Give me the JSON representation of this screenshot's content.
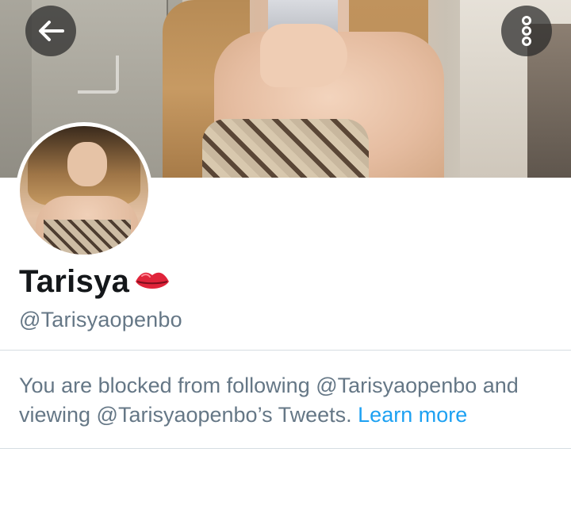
{
  "profile": {
    "display_name": "Tarisya",
    "name_emoji": "lips-icon",
    "handle": "@Tarisyaopenbo"
  },
  "header": {
    "back_icon": "back-arrow-icon",
    "more_icon": "more-options-icon"
  },
  "blocked": {
    "line1": "You are blocked from following @Tarisyaopenbo and viewing @Tarisyaopenbo’s Tweets.",
    "learn_more": "Learn more"
  },
  "colors": {
    "text_primary": "#14171a",
    "text_secondary": "#657786",
    "link": "#1da1f2",
    "divider": "#d6dde2",
    "icon_button_bg": "#282828"
  }
}
